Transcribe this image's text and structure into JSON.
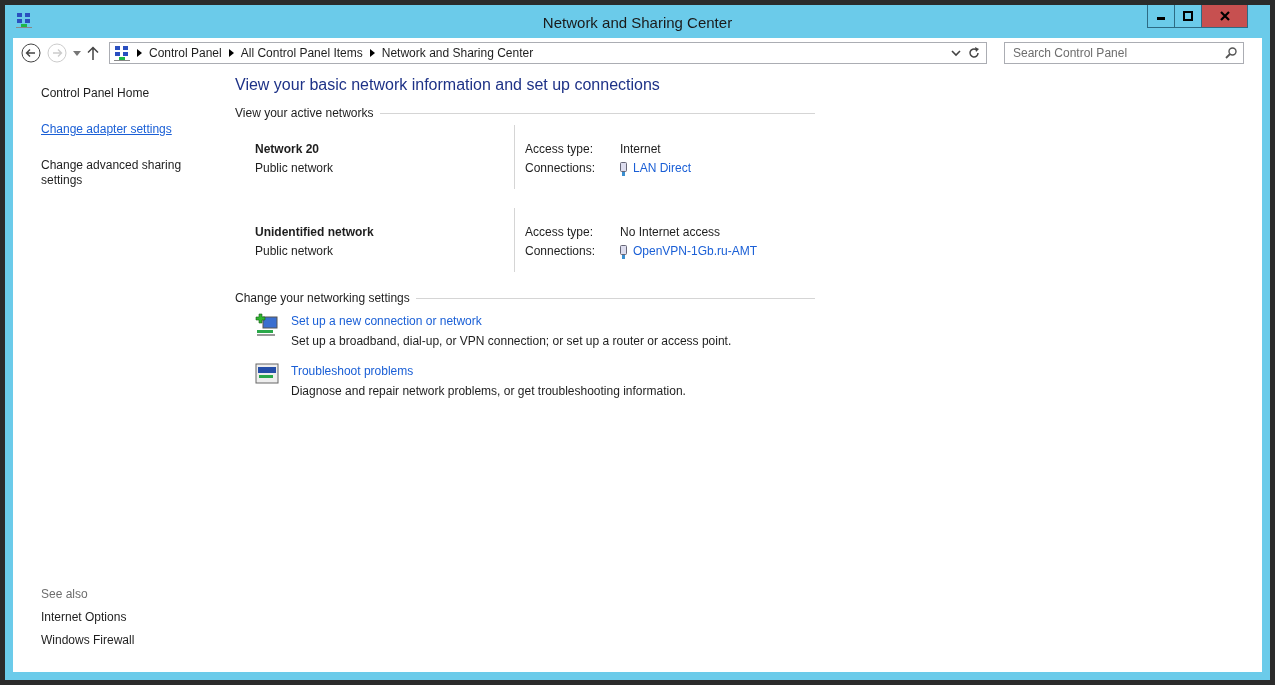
{
  "window": {
    "title": "Network and Sharing Center"
  },
  "breadcrumb": [
    "Control Panel",
    "All Control Panel Items",
    "Network and Sharing Center"
  ],
  "search": {
    "placeholder": "Search Control Panel"
  },
  "sidebar": {
    "items": [
      {
        "label": "Control Panel Home",
        "hovered": false
      },
      {
        "label": "Change adapter settings",
        "hovered": true
      },
      {
        "label": "Change advanced sharing settings",
        "hovered": false
      }
    ],
    "see_also_heading": "See also",
    "see_also": [
      "Internet Options",
      "Windows Firewall"
    ]
  },
  "heading": "View your basic network information and set up connections",
  "active_networks": {
    "title": "View your active networks",
    "networks": [
      {
        "name": "Network  20",
        "category": "Public network",
        "access_label": "Access type:",
        "access": "Internet",
        "connections_label": "Connections:",
        "connection": "LAN Direct"
      },
      {
        "name": "Unidentified network",
        "category": "Public network",
        "access_label": "Access type:",
        "access": "No Internet access",
        "connections_label": "Connections:",
        "connection": "OpenVPN-1Gb.ru-AMT"
      }
    ]
  },
  "networking_settings": {
    "title": "Change your networking settings",
    "tasks": [
      {
        "kind": "new-connection",
        "link": "Set up a new connection or network",
        "description": "Set up a broadband, dial-up, or VPN connection; or set up a router or access point."
      },
      {
        "kind": "troubleshoot",
        "link": "Troubleshoot problems",
        "description": "Diagnose and repair network problems, or get troubleshooting information."
      }
    ]
  }
}
